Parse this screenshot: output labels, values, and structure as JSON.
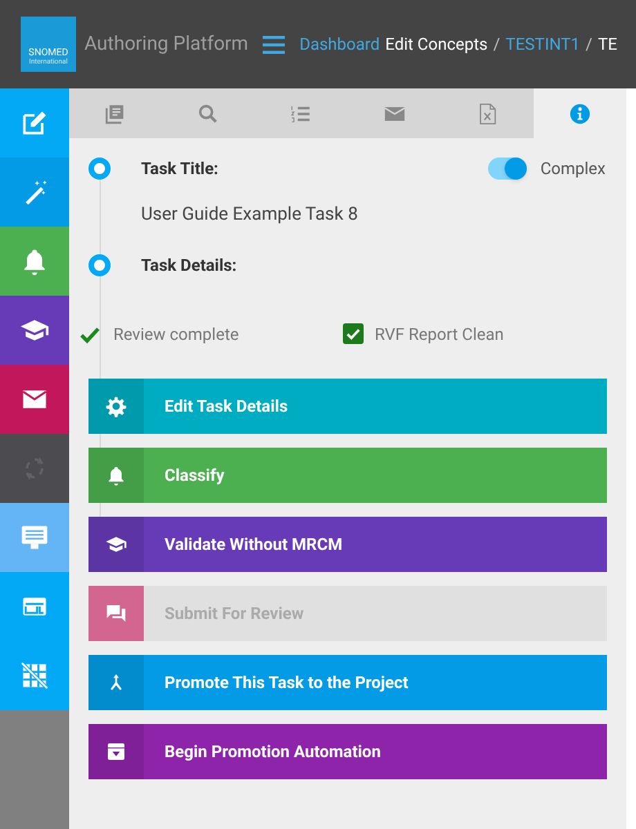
{
  "header": {
    "logo": {
      "line1": "SNOMED",
      "line2": "International"
    },
    "app_title": "Authoring Platform",
    "breadcrumb": [
      {
        "text": "Dashboard",
        "kind": "link"
      },
      {
        "text": "Edit Concepts",
        "kind": "plain"
      },
      {
        "text": "/",
        "kind": "sep"
      },
      {
        "text": "TESTINT1",
        "kind": "link"
      },
      {
        "text": "/",
        "kind": "sep"
      },
      {
        "text": "TE",
        "kind": "plain"
      }
    ]
  },
  "sidebar": {
    "items": [
      {
        "color": "#03a9f4",
        "disabled": false
      },
      {
        "color": "#039be5",
        "disabled": false
      },
      {
        "color": "#4caf50",
        "disabled": false
      },
      {
        "color": "#673ab7",
        "disabled": false
      },
      {
        "color": "#c2185b",
        "disabled": false
      },
      {
        "color": "#434348",
        "disabled": true
      },
      {
        "color": "#64b5f6",
        "disabled": false
      },
      {
        "color": "#03a9f4",
        "disabled": false
      },
      {
        "color": "#03a9f4",
        "disabled": false
      }
    ]
  },
  "tabs": [
    {
      "selected": false
    },
    {
      "selected": false
    },
    {
      "selected": false
    },
    {
      "selected": false
    },
    {
      "selected": false
    },
    {
      "selected": true
    }
  ],
  "task": {
    "title_label": "Task Title:",
    "complex": {
      "label": "Complex",
      "on": true
    },
    "title": "User Guide Example Task 8",
    "details_label": "Task Details:",
    "checks": [
      {
        "kind": "tick",
        "label": "Review complete",
        "checked": true
      },
      {
        "kind": "checkbox",
        "label": "RVF Report Clean",
        "checked": true
      }
    ]
  },
  "actions": [
    {
      "label": "Edit Task Details",
      "color": "#00acc1",
      "disabled": false
    },
    {
      "label": "Classify",
      "color": "#4caf50",
      "disabled": false
    },
    {
      "label": "Validate Without MRCM",
      "color": "#673ab7",
      "disabled": false
    },
    {
      "label": "Submit For Review",
      "color": "#e0e0e0",
      "disabled": true
    },
    {
      "label": "Promote This Task to the Project",
      "color": "#039be5",
      "disabled": false
    },
    {
      "label": "Begin Promotion Automation",
      "color": "#8e24aa",
      "disabled": false
    }
  ]
}
